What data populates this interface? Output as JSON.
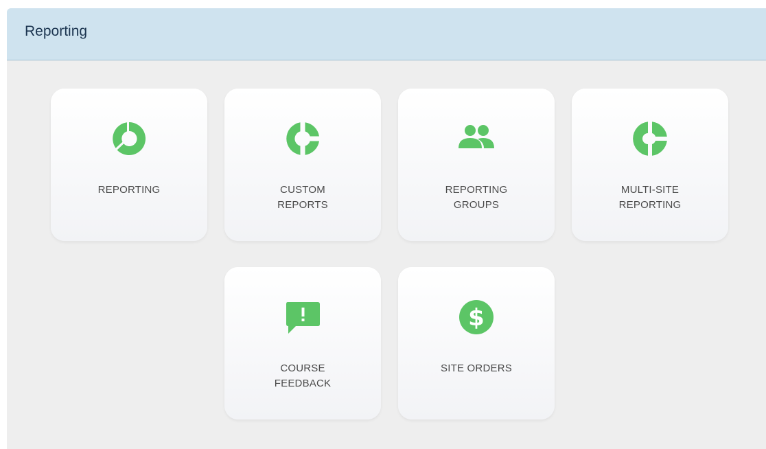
{
  "panel": {
    "title": "Reporting"
  },
  "tiles": [
    {
      "label_line1": "REPORTING",
      "label_line2": "",
      "icon": "donut-chart-icon"
    },
    {
      "label_line1": "CUSTOM",
      "label_line2": "REPORTS",
      "icon": "split-ring-icon"
    },
    {
      "label_line1": "REPORTING",
      "label_line2": "GROUPS",
      "icon": "users-group-icon"
    },
    {
      "label_line1": "MULTI-SITE",
      "label_line2": "REPORTING",
      "icon": "pie-chart-icon"
    },
    {
      "label_line1": "COURSE",
      "label_line2": "FEEDBACK",
      "icon": "feedback-alert-icon"
    },
    {
      "label_line1": "SITE ORDERS",
      "label_line2": "",
      "icon": "dollar-coin-icon"
    }
  ],
  "colors": {
    "accent_green": "#5cc566",
    "bar_green": "#1f9a14",
    "header_bg": "#cfe3ef",
    "title_text": "#1c3550",
    "label_text": "#4a4a4a"
  }
}
